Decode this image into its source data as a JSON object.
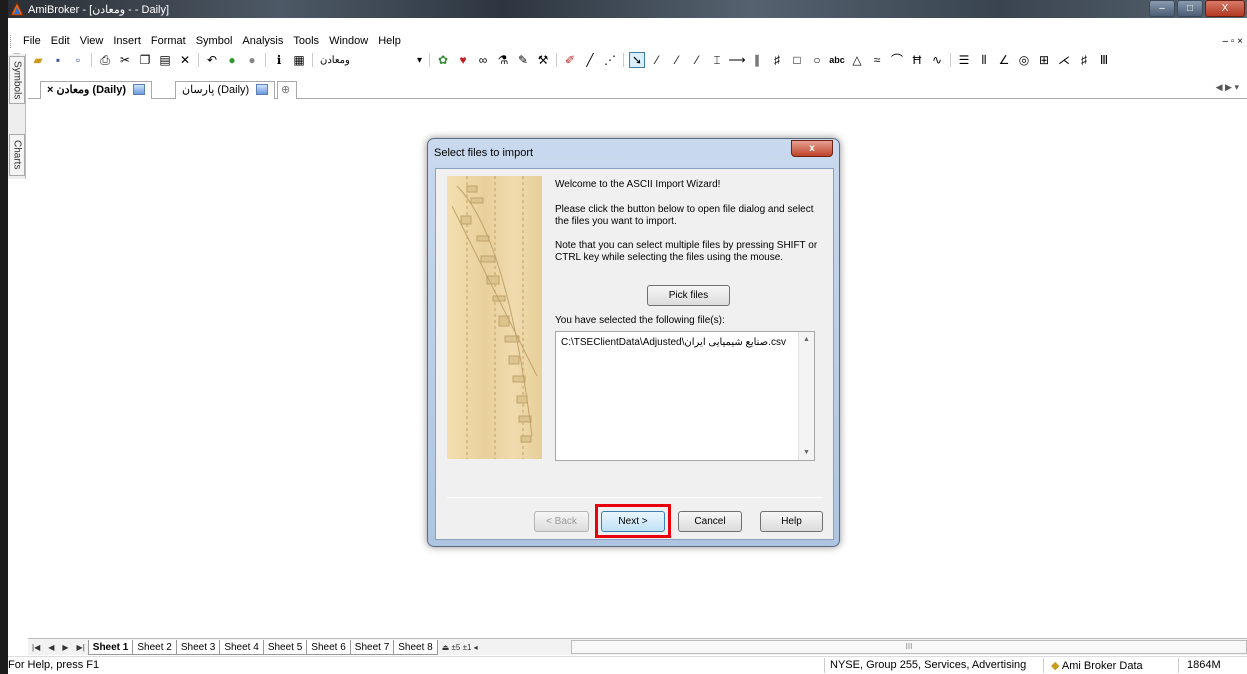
{
  "window": {
    "title": "AmiBroker - [ومعادن - - Daily]",
    "controls": [
      "–",
      "□",
      "X"
    ]
  },
  "menubar": {
    "items": [
      "File",
      "Edit",
      "View",
      "Insert",
      "Format",
      "Symbol",
      "Analysis",
      "Tools",
      "Window",
      "Help"
    ],
    "mdi_controls": "– ▫ ×"
  },
  "toolbar": {
    "symbol_combo": "ومعادن",
    "icons": [
      "new-icon",
      "open-icon",
      "save-icon",
      "save-all-icon",
      "print-icon",
      "cut-icon",
      "copy-icon",
      "paste-icon",
      "delete-icon",
      "undo-icon",
      "back-icon",
      "forward-icon",
      "info-icon",
      "calendar-icon"
    ],
    "drawing_text": "abc"
  },
  "sidebar": {
    "tabs": [
      "Symbols",
      "Charts"
    ]
  },
  "document_tabs": [
    {
      "label": "ومعادن (Daily)",
      "close": "×"
    },
    {
      "label": "پارسان (Daily)"
    }
  ],
  "dialog": {
    "title": "Select files to import",
    "close": "x",
    "welcome": "Welcome to the ASCII Import Wizard!",
    "instruction": "Please click the button below to open file dialog and select the files you want to import.",
    "note": "Note that you can select multiple files by pressing SHIFT or CTRL key while selecting the files using the mouse.",
    "pick_files": "Pick files",
    "selected_label": "You have selected the following file(s):",
    "files": [
      "C:\\TSEClientData\\Adjusted\\صنایع شیمیایی ایران.csv"
    ],
    "buttons": {
      "back": "< Back",
      "next": "Next >",
      "cancel": "Cancel",
      "help": "Help"
    }
  },
  "sheets": {
    "nav": [
      "|◀",
      "◀",
      "▶",
      "▶|"
    ],
    "tabs": [
      "Sheet 1",
      "Sheet 2",
      "Sheet 3",
      "Sheet 4",
      "Sheet 5",
      "Sheet 6",
      "Sheet 7",
      "Sheet 8"
    ],
    "active": "Sheet 1",
    "scroll_label": "III"
  },
  "statusbar": {
    "help": "For Help, press F1",
    "symbol_info": "NYSE, Group 255, Services, Advertising",
    "database": "Ami Broker Data",
    "memory": "1864M"
  },
  "colors": {
    "highlight": "#e8000b",
    "titlebar": "#2b2f35"
  }
}
